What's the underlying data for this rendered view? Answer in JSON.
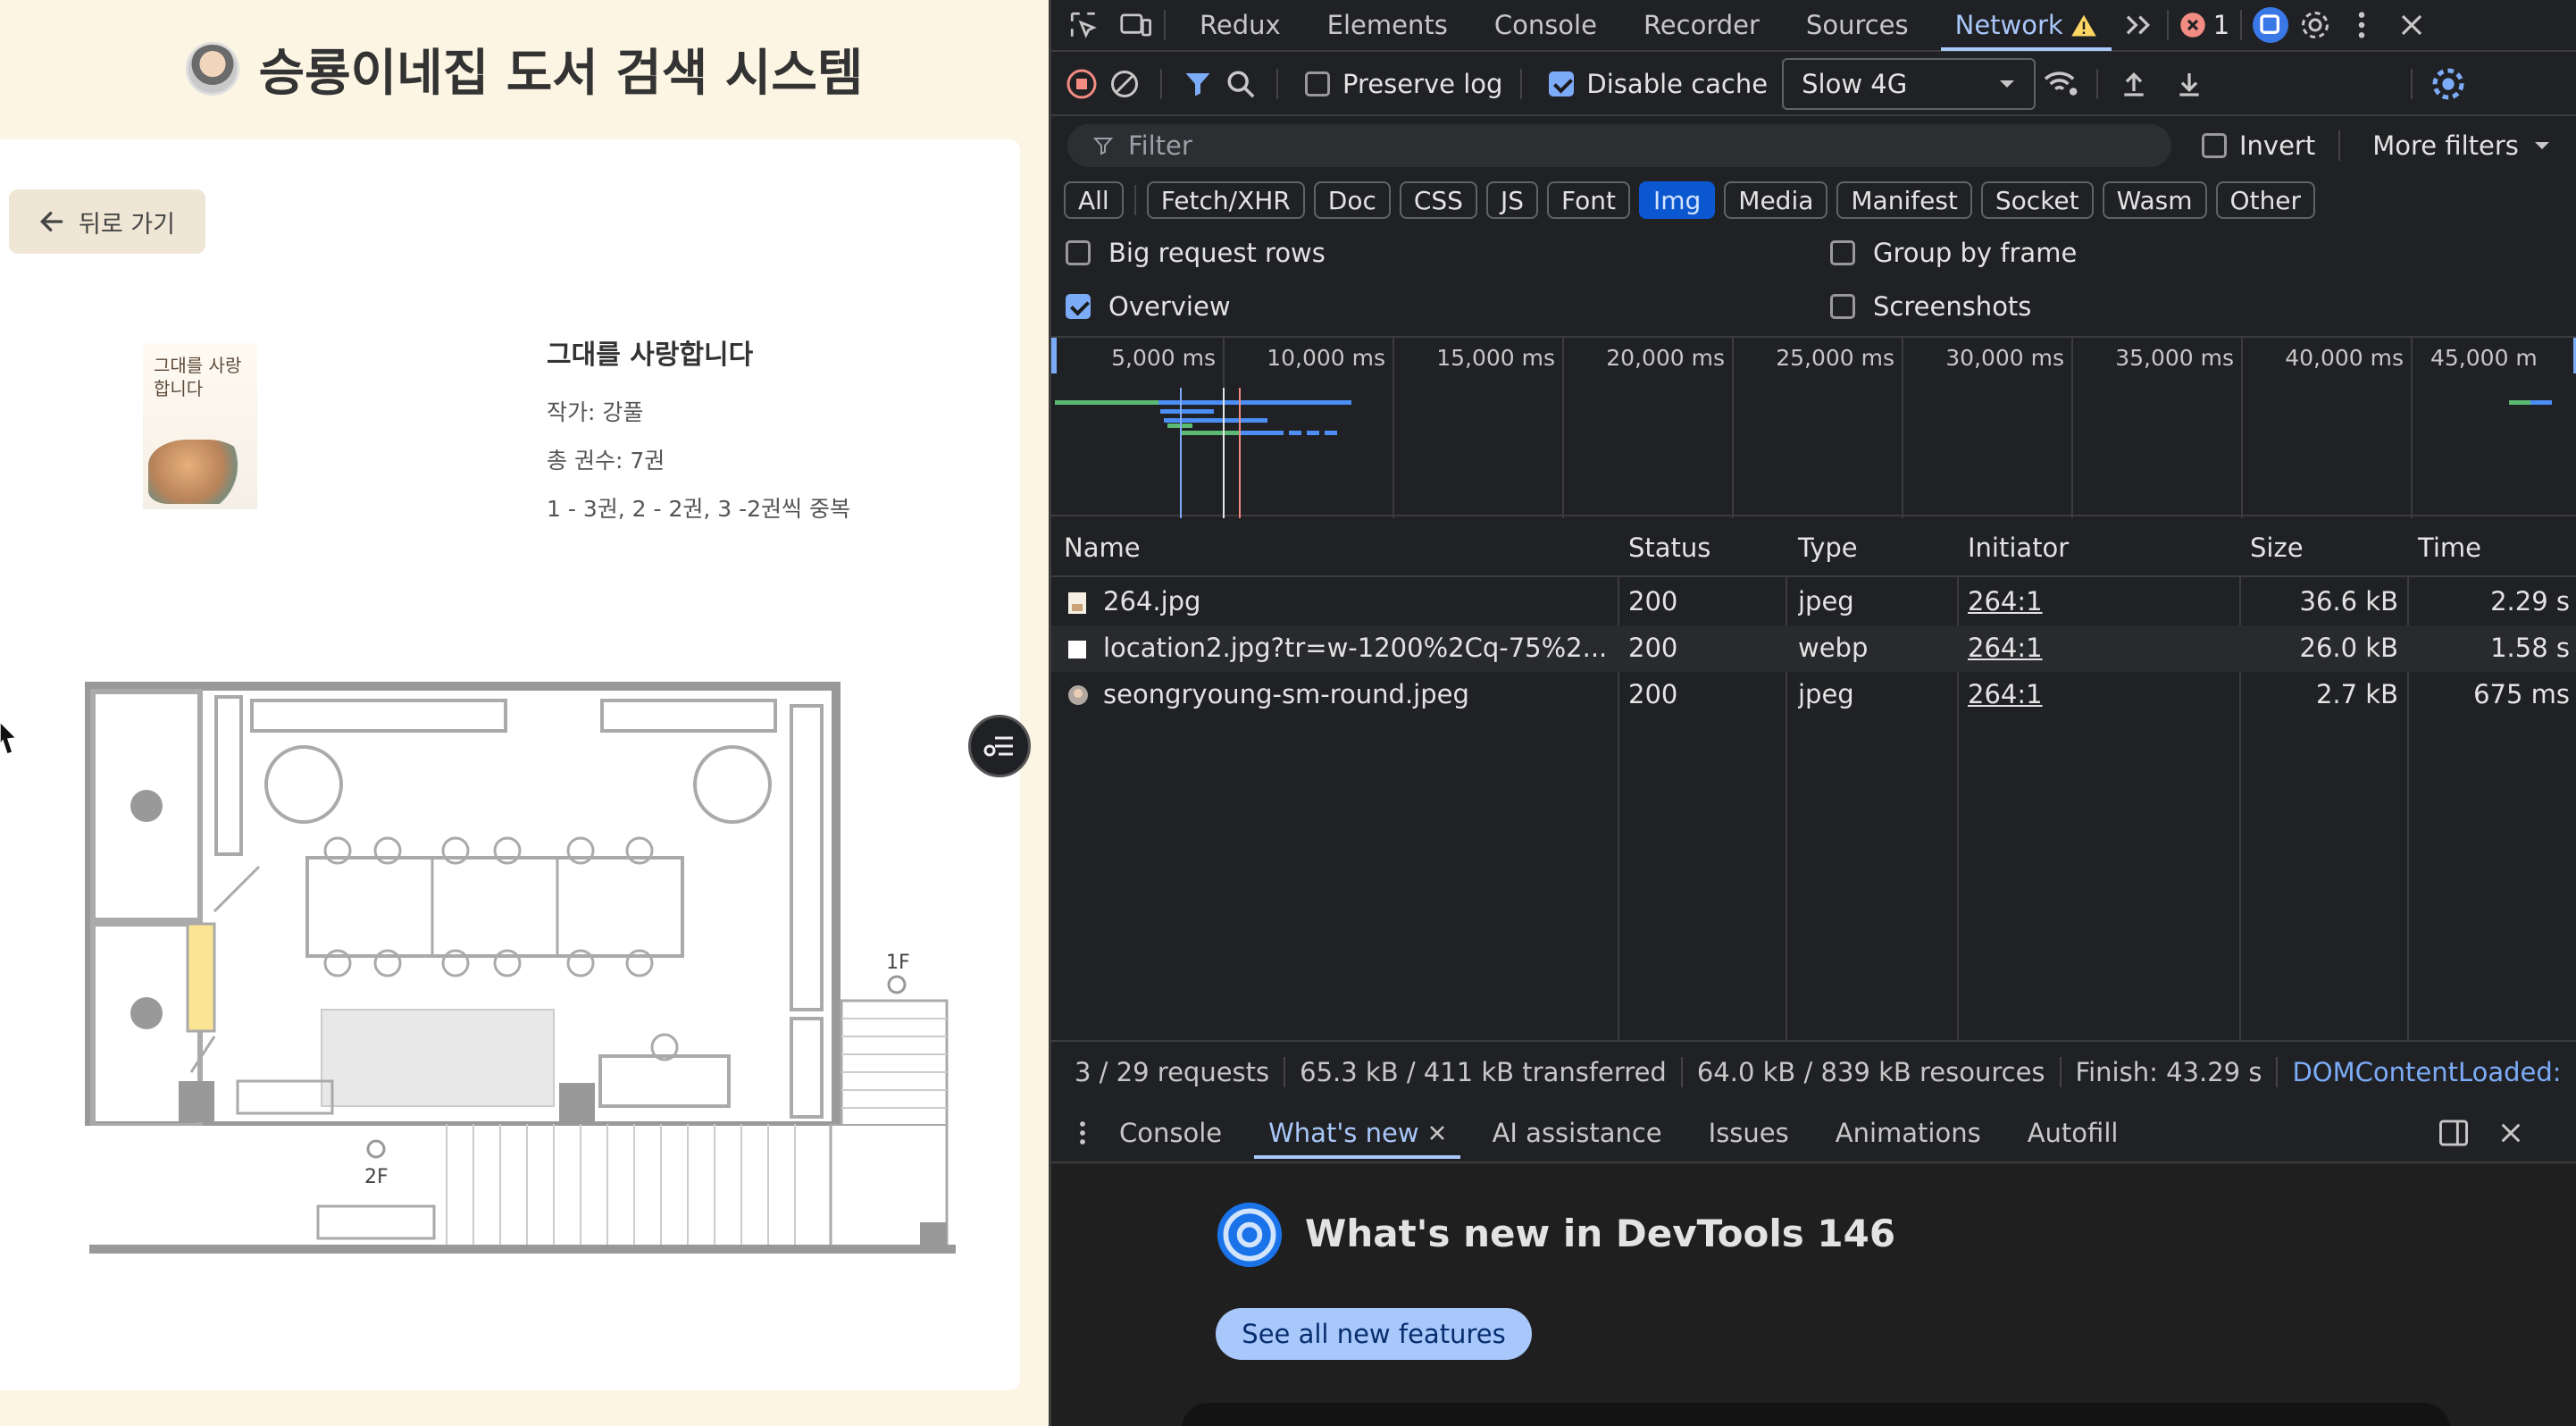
{
  "site": {
    "title": "승룡이네집 도서 검색 시스템",
    "back_label": "뒤로 가기"
  },
  "book": {
    "cover_text": "그대를 사랑합니다",
    "title": "그대를 사랑합니다",
    "author": "작가: 강풀",
    "total": "총 권수: 7권",
    "detail": "1 - 3권, 2 - 2권, 3 -2권씩 중복"
  },
  "map": {
    "floor_1f": "1F",
    "floor_2f": "2F"
  },
  "devtools": {
    "tabs": [
      "Redux",
      "Elements",
      "Console",
      "Recorder",
      "Sources",
      "Network"
    ],
    "error_count": "1",
    "toolbar": {
      "preserve_log": "Preserve log",
      "disable_cache": "Disable cache",
      "throttle": "Slow 4G"
    },
    "filter": {
      "placeholder": "Filter",
      "invert": "Invert",
      "more_filters": "More filters"
    },
    "types": [
      "All",
      "Fetch/XHR",
      "Doc",
      "CSS",
      "JS",
      "Font",
      "Img",
      "Media",
      "Manifest",
      "Socket",
      "Wasm",
      "Other"
    ],
    "active_type": "Img",
    "options": {
      "big_rows": "Big request rows",
      "group_by_frame": "Group by frame",
      "overview": "Overview",
      "screenshots": "Screenshots"
    },
    "timeline_ticks": [
      "5,000 ms",
      "10,000 ms",
      "15,000 ms",
      "20,000 ms",
      "25,000 ms",
      "30,000 ms",
      "35,000 ms",
      "40,000 ms",
      "45,000 m"
    ],
    "columns": [
      "Name",
      "Status",
      "Type",
      "Initiator",
      "Size",
      "Time"
    ],
    "rows": [
      {
        "name": "264.jpg",
        "status": "200",
        "type": "jpeg",
        "initiator": "264:1",
        "size": "36.6 kB",
        "time": "2.29 s"
      },
      {
        "name": "location2.jpg?tr=w-1200%2Cq-75%2...",
        "status": "200",
        "type": "webp",
        "initiator": "264:1",
        "size": "26.0 kB",
        "time": "1.58 s"
      },
      {
        "name": "seongryoung-sm-round.jpeg",
        "status": "200",
        "type": "jpeg",
        "initiator": "264:1",
        "size": "2.7 kB",
        "time": "675 ms"
      }
    ],
    "status": {
      "requests": "3 / 29 requests",
      "transferred": "65.3 kB / 411 kB transferred",
      "resources": "64.0 kB / 839 kB resources",
      "finish": "Finish: 43.29 s",
      "dcl": "DOMContentLoaded:"
    },
    "drawer_tabs": [
      "Console",
      "What's new",
      "AI assistance",
      "Issues",
      "Animations",
      "Autofill"
    ],
    "whats_new": {
      "title": "What's new in DevTools 146",
      "button": "See all new features"
    }
  }
}
